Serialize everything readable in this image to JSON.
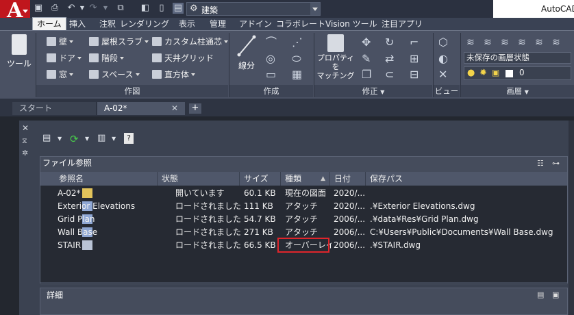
{
  "app": {
    "logo_letter": "A",
    "logo_sub": "A",
    "name": "AutoCAD A",
    "workspace": "建築"
  },
  "ribbon_tabs": [
    "ホーム",
    "挿入",
    "注釈",
    "レンダリング",
    "表示",
    "管理",
    "アドイン",
    "コラボレート",
    "Vision ツール",
    "注目アプリ"
  ],
  "ribbon": {
    "big_tool": "ツール",
    "design_items": [
      "壁",
      "ドア",
      "窓",
      "屋根スラブ",
      "階段",
      "スペース",
      "カスタム柱通芯",
      "天井グリッド",
      "直方体"
    ],
    "panel_design": "作図",
    "line_label": "線分",
    "panel_create": "作成",
    "match_label_1": "プロパティを",
    "match_label_2": "マッチング",
    "panel_modify": "修正",
    "panel_view": "ビュー",
    "layer_state": "未保存の画層状態",
    "layer_current": "0",
    "panel_layer": "画層"
  },
  "doc_tabs": {
    "start": "スタート",
    "current": "A-02*"
  },
  "palette": {
    "file_panel_title": "ファイル参照",
    "detail_panel_title": "詳細",
    "columns": [
      "参照名",
      "状態",
      "サイズ",
      "種類",
      "日付",
      "保存パス"
    ],
    "rows": [
      {
        "name": "A-02*",
        "status": "開いています",
        "size": "60.1 KB",
        "type": "現在の図面",
        "date": "2020/...",
        "path": ""
      },
      {
        "name": "Exterior Elevations",
        "status": "ロードされました",
        "size": "111 KB",
        "type": "アタッチ",
        "date": "2020/...",
        "path": ".¥Exterior Elevations.dwg"
      },
      {
        "name": "Grid Plan",
        "status": "ロードされました",
        "size": "54.7 KB",
        "type": "アタッチ",
        "date": "2006/...",
        "path": ".¥data¥Res¥Grid Plan.dwg"
      },
      {
        "name": "Wall Base",
        "status": "ロードされました",
        "size": "271 KB",
        "type": "アタッチ",
        "date": "2006/...",
        "path": "C:¥Users¥Public¥Documents¥Wall Base.dwg"
      },
      {
        "name": "STAIR",
        "status": "ロードされました",
        "size": "66.5 KB",
        "type": "オーバーレイ",
        "date": "2006/...",
        "path": ".¥STAIR.dwg"
      }
    ]
  },
  "colors": {
    "accent_red": "#e0252b",
    "app_red": "#c0161d"
  }
}
